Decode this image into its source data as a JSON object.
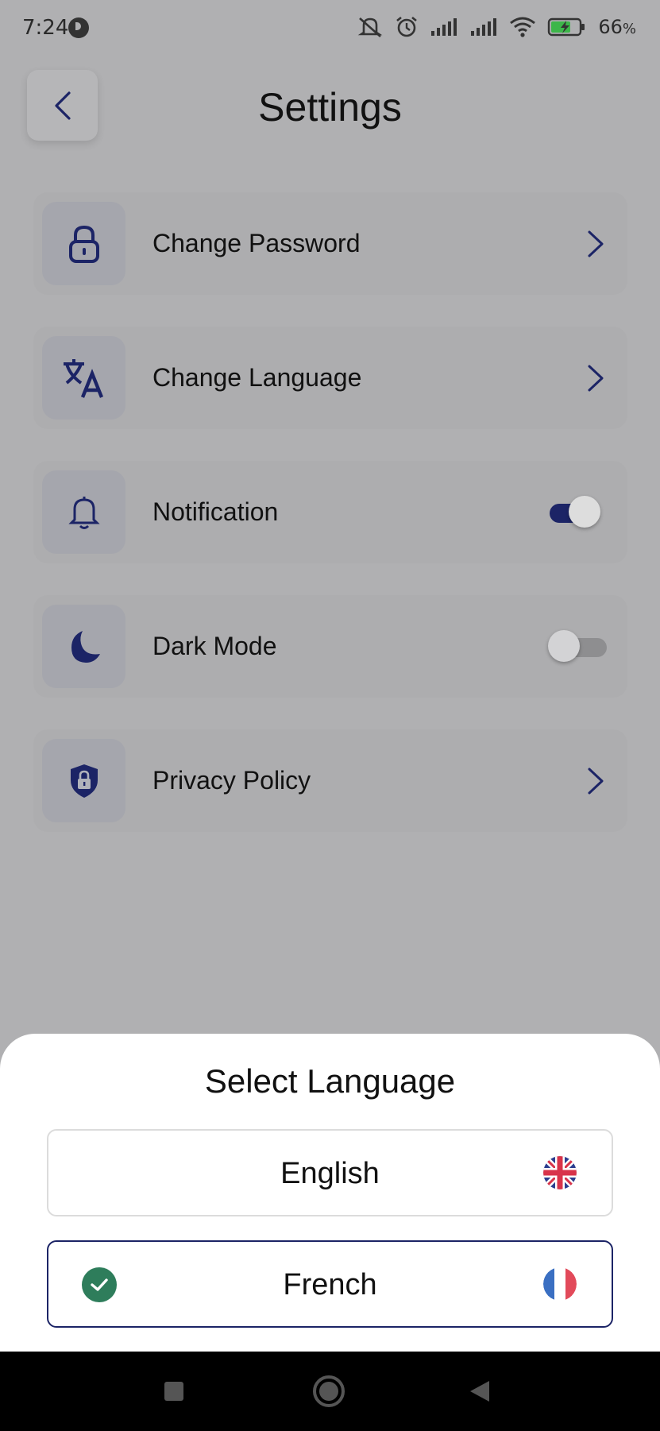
{
  "status_bar": {
    "time": "7:24",
    "battery_percent": "66",
    "battery_percent_suffix": "%",
    "icons": [
      "app-notification-icon",
      "mute-icon",
      "alarm-icon",
      "signal-icon",
      "signal-icon-2",
      "wifi-icon",
      "battery-charging-icon"
    ]
  },
  "header": {
    "title": "Settings",
    "back_icon": "chevron-left-icon"
  },
  "settings": {
    "items": [
      {
        "label": "Change Password",
        "icon": "lock-icon",
        "control": "chevron"
      },
      {
        "label": "Change Language",
        "icon": "translate-icon",
        "control": "chevron"
      },
      {
        "label": "Notification",
        "icon": "bell-icon",
        "control": "toggle",
        "enabled": true
      },
      {
        "label": "Dark Mode",
        "icon": "moon-icon",
        "control": "toggle",
        "enabled": false
      },
      {
        "label": "Privacy Policy",
        "icon": "shield-lock-icon",
        "control": "chevron"
      }
    ]
  },
  "language_sheet": {
    "title": "Select Language",
    "options": [
      {
        "label": "English",
        "flag": "uk-flag-icon",
        "selected": false
      },
      {
        "label": "French",
        "flag": "france-flag-icon",
        "selected": true
      }
    ]
  },
  "colors": {
    "accent": "#1c2466",
    "selected_check": "#2e7d5b",
    "overlay_bg": "#b0b0b2"
  },
  "nav_bar": {
    "buttons": [
      "recents-square-icon",
      "home-circle-icon",
      "back-triangle-icon"
    ]
  }
}
